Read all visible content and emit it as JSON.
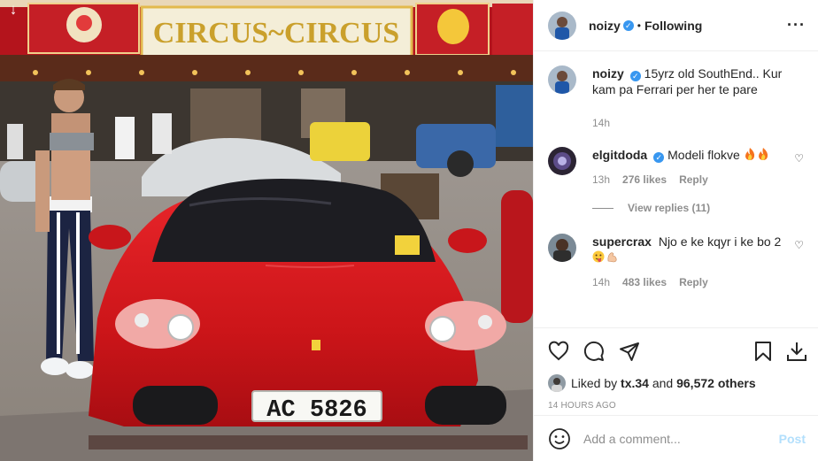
{
  "photo": {
    "banner_text": "CIRCUS~CIRCUS",
    "plate_text": "AC 5826",
    "download_icon": "arrow-down-icon"
  },
  "post": {
    "author": "noizy",
    "follow_status": "Following",
    "caption": "15yrz old SouthEnd.. Kur kam pa Ferrari per her te pare",
    "caption_age": "14h"
  },
  "comments": [
    {
      "user": "elgitdoda",
      "verified": true,
      "text": "Modeli flokve",
      "emoji": [
        "fire",
        "fire"
      ],
      "age": "13h",
      "likes": "276 likes",
      "reply_label": "Reply",
      "view_replies": "View replies (11)"
    },
    {
      "user": "supercrax",
      "verified": false,
      "text": "Njo e ke kqyr i ke bo 2",
      "emoji": [
        "face-with-tongue",
        "flexed-biceps"
      ],
      "age": "14h",
      "likes": "483 likes",
      "reply_label": "Reply"
    }
  ],
  "actions": {
    "liked_prefix": "Liked by",
    "liked_user": "tx.34",
    "liked_and": "and",
    "liked_count": "96,572 others",
    "timestamp": "14 HOURS AGO"
  },
  "add_comment": {
    "placeholder": "Add a comment...",
    "post_label": "Post"
  },
  "colors": {
    "verified": "#3897f0",
    "muted": "#8e8e8e",
    "post_disabled": "#b2dffc",
    "ferrari_red": "#d41a1f"
  }
}
